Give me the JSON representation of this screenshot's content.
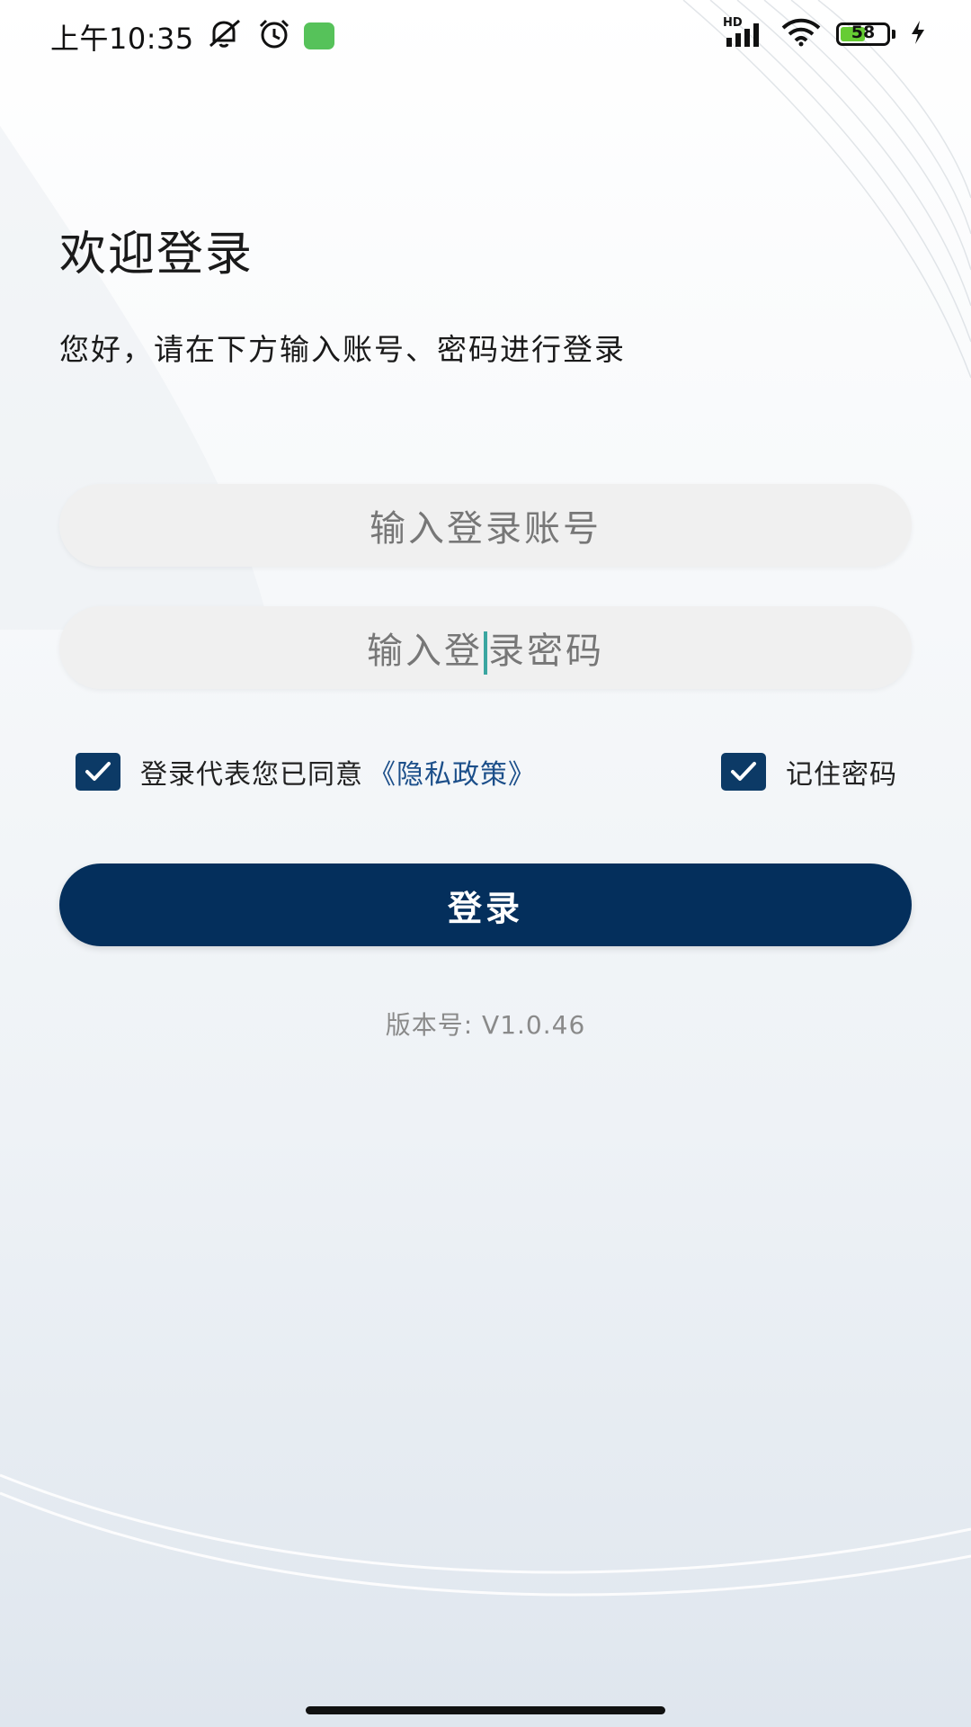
{
  "status_bar": {
    "time": "上午10:35",
    "battery_level": "58",
    "battery_fraction": 0.58,
    "network_label": "HD",
    "icons": [
      "mute-icon",
      "alarm-icon",
      "app-badge-icon",
      "signal-icon",
      "wifi-icon",
      "battery-icon",
      "charging-icon"
    ]
  },
  "login": {
    "title": "欢迎登录",
    "subtitle": "您好，请在下方输入账号、密码进行登录",
    "account_placeholder": "输入登录账号",
    "password_placeholder_before_caret": "输入登",
    "password_placeholder_after_caret": "录密码",
    "agreement_label": "登录代表您已同意",
    "policy_link": "《隐私政策》",
    "agreement_checked": true,
    "remember_label": "记住密码",
    "remember_checked": true,
    "submit_label": "登录",
    "version": "版本号: V1.0.46"
  },
  "colors": {
    "primary": "#042f5c",
    "checkbox": "#0c3a66",
    "link": "#1c4f8a",
    "field_bg": "#f0f0f0",
    "caret": "#3aa6a0",
    "battery_fill": "#66cc33",
    "app_badge": "#56c25a"
  }
}
